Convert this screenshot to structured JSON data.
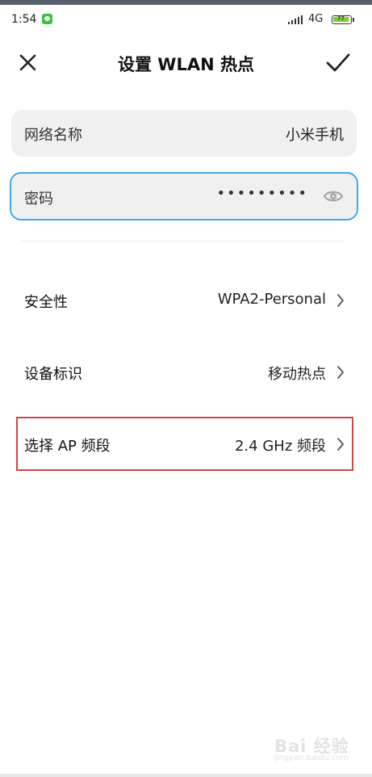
{
  "status_bar": {
    "time": "1:54",
    "network": "4G",
    "battery_level": "77"
  },
  "header": {
    "title": "设置 WLAN 热点"
  },
  "fields": {
    "ssid": {
      "label": "网络名称",
      "value": "小米手机"
    },
    "password": {
      "label": "密码",
      "masked_value": "•••••••••"
    }
  },
  "settings": {
    "security": {
      "label": "安全性",
      "value": "WPA2-Personal"
    },
    "device_identifier": {
      "label": "设备标识",
      "value": "移动热点"
    },
    "ap_band": {
      "label": "选择 AP 频段",
      "value": "2.4 GHz 频段"
    }
  },
  "watermark": {
    "logo": "Bai 经验",
    "url": "jingyan.baidu.com"
  },
  "colors": {
    "accent_blue": "#45a6e8",
    "highlight_red": "#d64545",
    "field_background": "#f0f0f0",
    "battery_green": "#7ccf2d"
  },
  "icons": {
    "close": "close-icon",
    "confirm": "check-icon",
    "password_visibility": "eye-icon",
    "row_arrow": "chevron-right-icon"
  }
}
